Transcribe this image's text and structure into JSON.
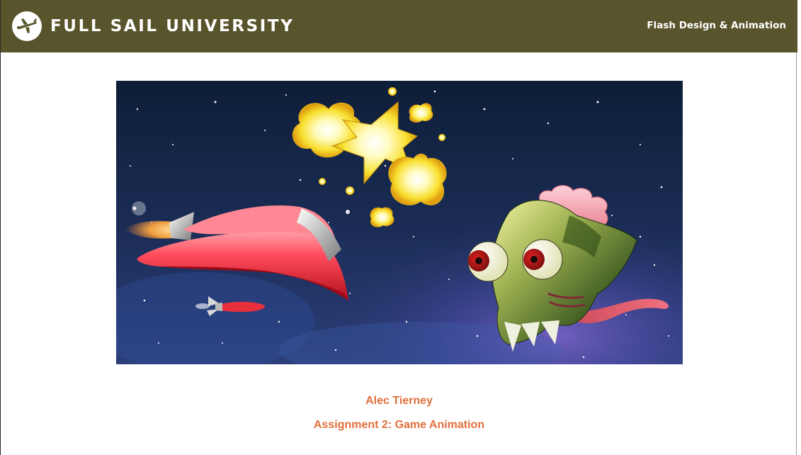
{
  "header": {
    "brand": "FULL SAIL UNIVERSITY",
    "trademark": "™",
    "program": "Flash Design & Animation",
    "background_color": "#58542c"
  },
  "logo": {
    "icon": "airplane-logo-icon"
  },
  "hero": {
    "description_icons": [
      "red-spaceship",
      "missile",
      "explosion",
      "green-alien-skull-with-brain"
    ]
  },
  "credits": {
    "student_name": "Alec Tierney",
    "assignment_title": "Assignment 2: Game Animation",
    "text_color": "#e0703c"
  }
}
